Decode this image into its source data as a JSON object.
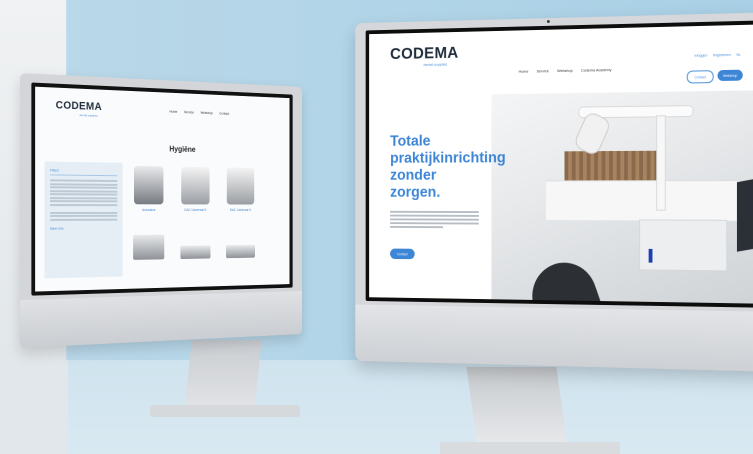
{
  "left_site": {
    "logo": "CODEMA",
    "logo_sub": "dental supplies",
    "nav": [
      "Home",
      "Service",
      "Webshop",
      "Contact"
    ],
    "page_title": "Hygiëne",
    "sidebar_header": "Filters",
    "sidebar_more": "Meer info",
    "products": [
      {
        "caption": "Autoclave"
      },
      {
        "caption": "DAC Universal S"
      },
      {
        "caption": "DAC Universal S"
      }
    ]
  },
  "right_site": {
    "logo": "CODEMA",
    "logo_sub": "dental supplies",
    "nav": [
      "Home",
      "Service",
      "Webshop",
      "Codema Academy"
    ],
    "top_links": [
      "Inloggen",
      "Registreren",
      "NL"
    ],
    "btn_outline": "Contact",
    "btn_filled": "Webshop",
    "hero": [
      "Totale",
      "praktijkinrichting",
      "zonder",
      "zorgen."
    ],
    "hero_button": "Contact"
  }
}
